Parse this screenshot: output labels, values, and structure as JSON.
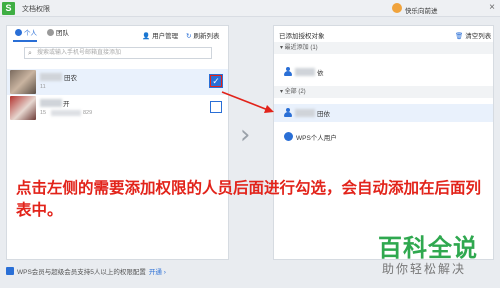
{
  "window": {
    "logo": "S",
    "title": "文档权限",
    "user_name": "快乐向前进",
    "close_glyph": "×"
  },
  "left_panel": {
    "tabs": [
      {
        "label": "个人",
        "active": true
      },
      {
        "label": "团队",
        "active": false
      }
    ],
    "actions": {
      "manage_label": "用户管理",
      "refresh_label": "刷新列表"
    },
    "search": {
      "placeholder": "搜索或输入手机号邮箱直接添加"
    },
    "contacts": [
      {
        "name_suffix": "田农",
        "sub_text": "11",
        "checked": true
      },
      {
        "name_suffix": "开",
        "sub_text": "15",
        "sub_suffix": "829",
        "checked": false
      }
    ]
  },
  "right_panel": {
    "header": "已添加授权对象",
    "clear_label": "清空列表",
    "sections": {
      "recent_label": "▾ 最近添加 (1)",
      "all_label": "▾ 全部 (2)"
    },
    "recent_items": [
      {
        "name_suffix": "依"
      }
    ],
    "all_items": [
      {
        "name_suffix": "田依"
      },
      {
        "label": "WPS个人用户"
      }
    ]
  },
  "instruction_text": "点击左侧的需要添加权限的人员后面进行勾选，会自动添加在后面列表中。",
  "footer": {
    "text": "WPS会员与超级会员支持5人以上的权限配置",
    "link": "开通 ›"
  },
  "watermark": {
    "title": "百科全说",
    "subtitle": "助你轻松解决"
  },
  "colors": {
    "accent": "#2a6fd6",
    "annotation_red": "#e2231a",
    "brand_green": "#3fae43"
  },
  "icons": [
    "app-logo-icon",
    "person-icon",
    "team-icon",
    "user-manage-icon",
    "refresh-icon",
    "search-icon",
    "check-icon",
    "trash-icon",
    "wps-icon",
    "chevron-right-icon",
    "red-arrow"
  ]
}
